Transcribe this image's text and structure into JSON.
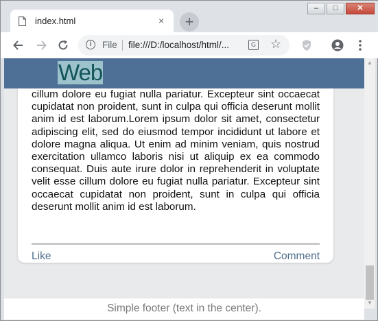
{
  "browser": {
    "tab_title": "index.html",
    "tab_close": "×",
    "new_tab": "+",
    "address": {
      "scheme_label": "File",
      "url": "file:///D:/localhost/html/..."
    },
    "window_controls": {
      "minimize": "–",
      "maximize": "□",
      "close": "✕"
    }
  },
  "page": {
    "logo": "Web",
    "card": {
      "body": "cillum dolore eu fugiat nulla pariatur. Excepteur sint occaecat cupidatat non proident, sunt in culpa qui officia deserunt mollit anim id est laborum.Lorem ipsum dolor sit amet, consectetur adipiscing elit, sed do eiusmod tempor incididunt ut labore et dolore magna aliqua. Ut enim ad minim veniam, quis nostrud exercitation ullamco laboris nisi ut aliquip ex ea commodo consequat. Duis aute irure dolor in reprehenderit in voluptate velit esse cillum dolore eu fugiat nulla pariatur. Excepteur sint occaecat cupidatat non proident, sunt in culpa qui officia deserunt mollit anim id est laborum.",
      "like": "Like",
      "comment": "Comment"
    },
    "footer": "Simple footer (text in the center)."
  }
}
